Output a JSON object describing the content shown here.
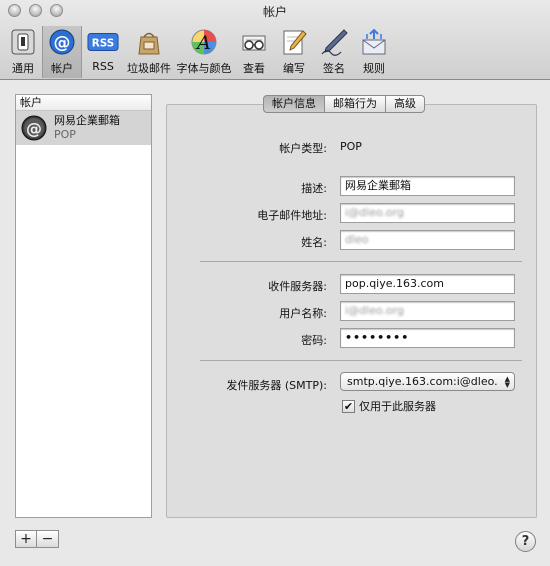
{
  "window": {
    "title": "帐户"
  },
  "toolbar": {
    "items": [
      {
        "label": "通用",
        "icon": "general-switch-icon",
        "active": false
      },
      {
        "label": "帐户",
        "icon": "at-sign-icon",
        "active": true
      },
      {
        "label": "RSS",
        "icon": "rss-icon",
        "active": false,
        "badge": "RSS"
      },
      {
        "label": "垃圾邮件",
        "icon": "junk-mail-bag-icon",
        "active": false
      },
      {
        "label": "字体与颜色",
        "icon": "fonts-colors-icon",
        "active": false,
        "glyph": "A"
      },
      {
        "label": "查看",
        "icon": "viewing-glasses-icon",
        "active": false
      },
      {
        "label": "编写",
        "icon": "composing-pencil-icon",
        "active": false
      },
      {
        "label": "签名",
        "icon": "signature-pen-icon",
        "active": false
      },
      {
        "label": "规则",
        "icon": "rules-envelope-icon",
        "active": false
      }
    ]
  },
  "accounts": {
    "header": "帐户",
    "items": [
      {
        "name": "网易企業郵箱",
        "type": "POP"
      }
    ]
  },
  "tabs": [
    "帐户信息",
    "邮箱行为",
    "高级"
  ],
  "form": {
    "account_type_label": "帐户类型:",
    "account_type_value": "POP",
    "description_label": "描述:",
    "description_value": "网易企業郵箱",
    "email_label": "电子邮件地址:",
    "email_value": "i@dleo.org",
    "fullname_label": "姓名:",
    "fullname_value": "dleo",
    "incoming_label": "收件服务器:",
    "incoming_value": "pop.qiye.163.com",
    "username_label": "用户名称:",
    "username_value": "i@dleo.org",
    "password_label": "密码:",
    "password_value": "••••••••",
    "smtp_label": "发件服务器 (SMTP):",
    "smtp_value": "smtp.qiye.163.com:i@dleo.",
    "smtp_only_label": "仅用于此服务器",
    "smtp_only_checked": true
  },
  "buttons": {
    "add": "+",
    "remove": "−",
    "help": "?"
  }
}
